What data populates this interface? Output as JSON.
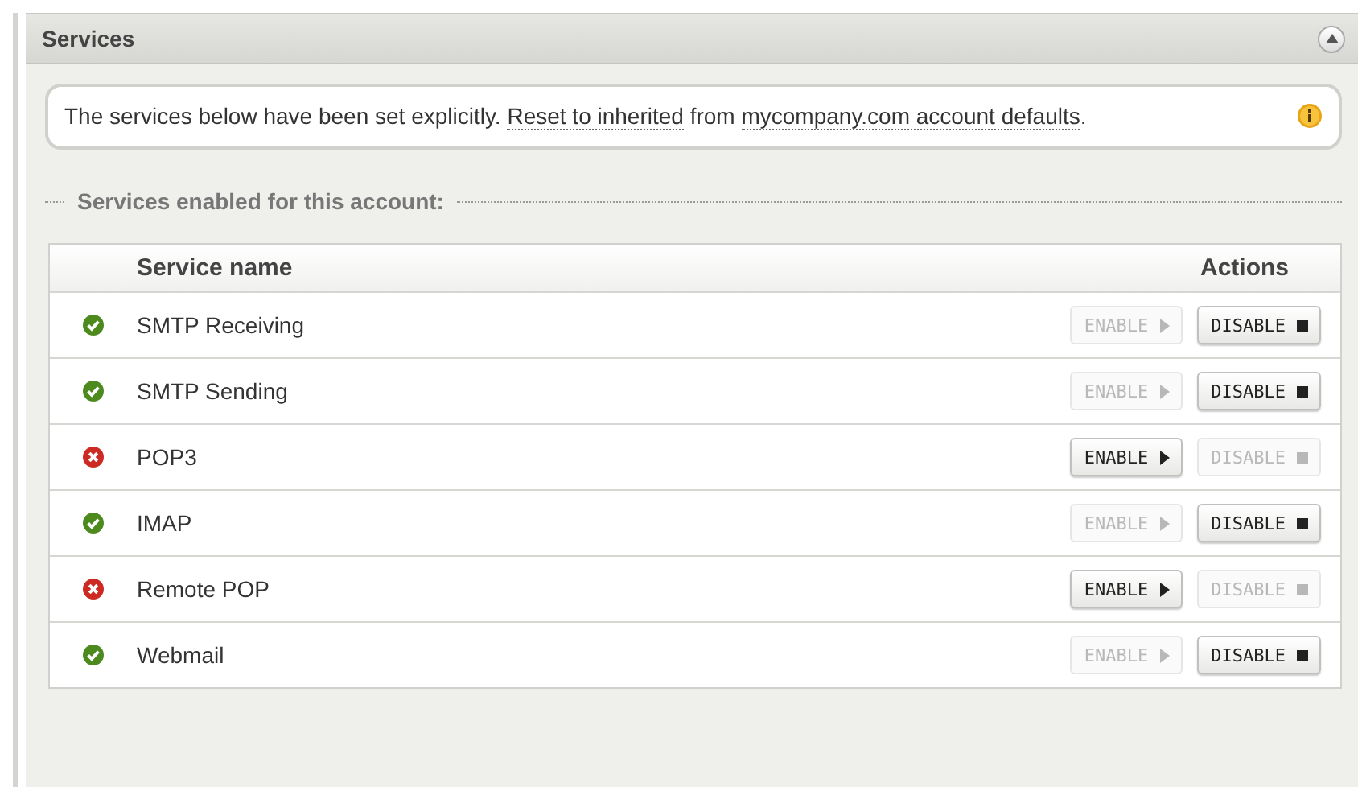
{
  "panel": {
    "title": "Services",
    "collapsed": false
  },
  "notice": {
    "text": "The services below have been set explicitly. ",
    "link": "Reset to inherited",
    "middle": " from ",
    "link2": "mycompany.com account defaults",
    "end": "."
  },
  "section_title": "Services enabled for this account:",
  "table": {
    "columns": [
      "Service name",
      "Actions"
    ],
    "rows": [
      {
        "name": "SMTP Receiving",
        "enabled": true,
        "enable_label": "ENABLE",
        "disable_label": "DISABLE"
      },
      {
        "name": "SMTP Sending",
        "enabled": true,
        "enable_label": "ENABLE",
        "disable_label": "DISABLE"
      },
      {
        "name": "POP3",
        "enabled": false,
        "enable_label": "ENABLE",
        "disable_label": "DISABLE"
      },
      {
        "name": "IMAP",
        "enabled": true,
        "enable_label": "ENABLE",
        "disable_label": "DISABLE"
      },
      {
        "name": "Remote POP",
        "enabled": false,
        "enable_label": "ENABLE",
        "disable_label": "DISABLE"
      },
      {
        "name": "Webmail",
        "enabled": true,
        "enable_label": "ENABLE",
        "disable_label": "DISABLE"
      }
    ]
  }
}
